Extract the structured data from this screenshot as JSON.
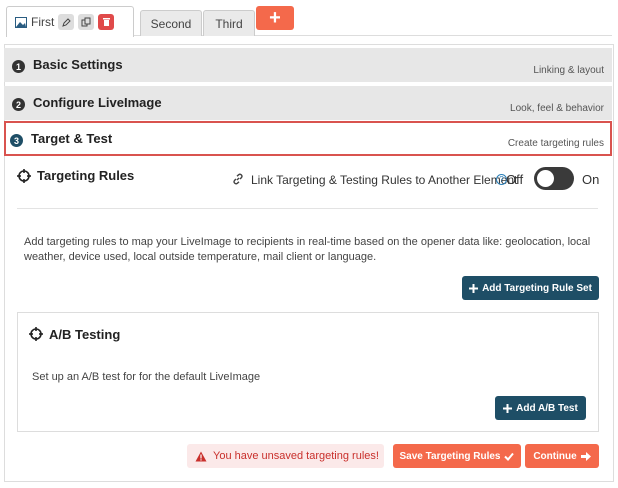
{
  "tabs": {
    "first": "First",
    "second": "Second",
    "third": "Third",
    "add": "+"
  },
  "steps": [
    {
      "num": "1",
      "title": "Basic Settings",
      "subtitle": "Linking & layout"
    },
    {
      "num": "2",
      "title": "Configure LiveImage",
      "subtitle": "Look, feel & behavior"
    },
    {
      "num": "3",
      "title": "Target & Test",
      "subtitle": "Create targeting rules"
    }
  ],
  "targeting": {
    "title": "Targeting Rules",
    "link_text": "Link Targeting & Testing Rules to Another Element",
    "help": "?",
    "off_label": "Off",
    "on_label": "On",
    "toggle_state": "off",
    "description": "Add targeting rules to map your LiveImage to recipients in real-time based on the opener data like: geolocation, local weather, device used, local outside temperature, mail client or language.",
    "add_rule_set_label": "Add Targeting Rule Set"
  },
  "ab_testing": {
    "title": "A/B Testing",
    "description": "Set up an A/B test for for the default LiveImage",
    "add_label": "Add A/B Test"
  },
  "footer": {
    "warning": "You have unsaved targeting rules!",
    "save_label": "Save Targeting Rules",
    "continue_label": "Continue"
  },
  "colors": {
    "accent_orange": "#f4694b",
    "dark_teal": "#1e4e66",
    "highlight_red": "#d9534f"
  }
}
